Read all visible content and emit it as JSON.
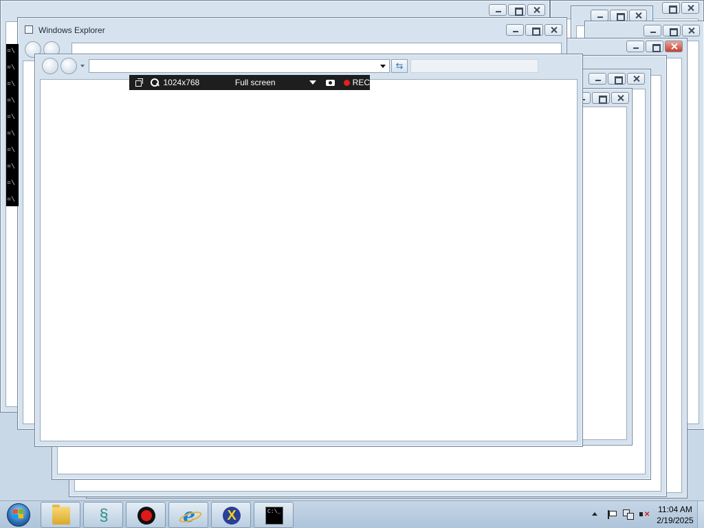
{
  "front_window": {
    "title": "Windows Explorer"
  },
  "record_toolbar": {
    "resolution": "1024x768",
    "mode": "Full screen",
    "rec_label": "REC"
  },
  "taskbar": {
    "pinned": [
      {
        "name": "windows-explorer",
        "icon": "folder-icon"
      },
      {
        "name": "kali-dragon",
        "icon": "dragon-icon"
      },
      {
        "name": "screen-recorder",
        "icon": "record-icon"
      },
      {
        "name": "internet-explorer",
        "icon": "ie-icon",
        "glyph": "e"
      },
      {
        "name": "xming",
        "icon": "x-icon",
        "glyph": "X"
      },
      {
        "name": "command-prompt",
        "icon": "cmd-icon",
        "glyph": "C:\\_"
      }
    ],
    "clock": {
      "time": "11:04 AM",
      "date": "2/19/2025"
    }
  },
  "console_lines": [
    "=\\",
    "=\\",
    "=\\",
    "=\\",
    "=\\",
    "=\\",
    "=\\",
    "=\\",
    "=\\",
    "=\\"
  ],
  "colors": {
    "desktop": "#c9d8e6",
    "window_frame": "#d6e3ef",
    "taskbar": "#b9cde0",
    "record_bar": "#1e1e1e",
    "rec_dot": "#e02020"
  }
}
